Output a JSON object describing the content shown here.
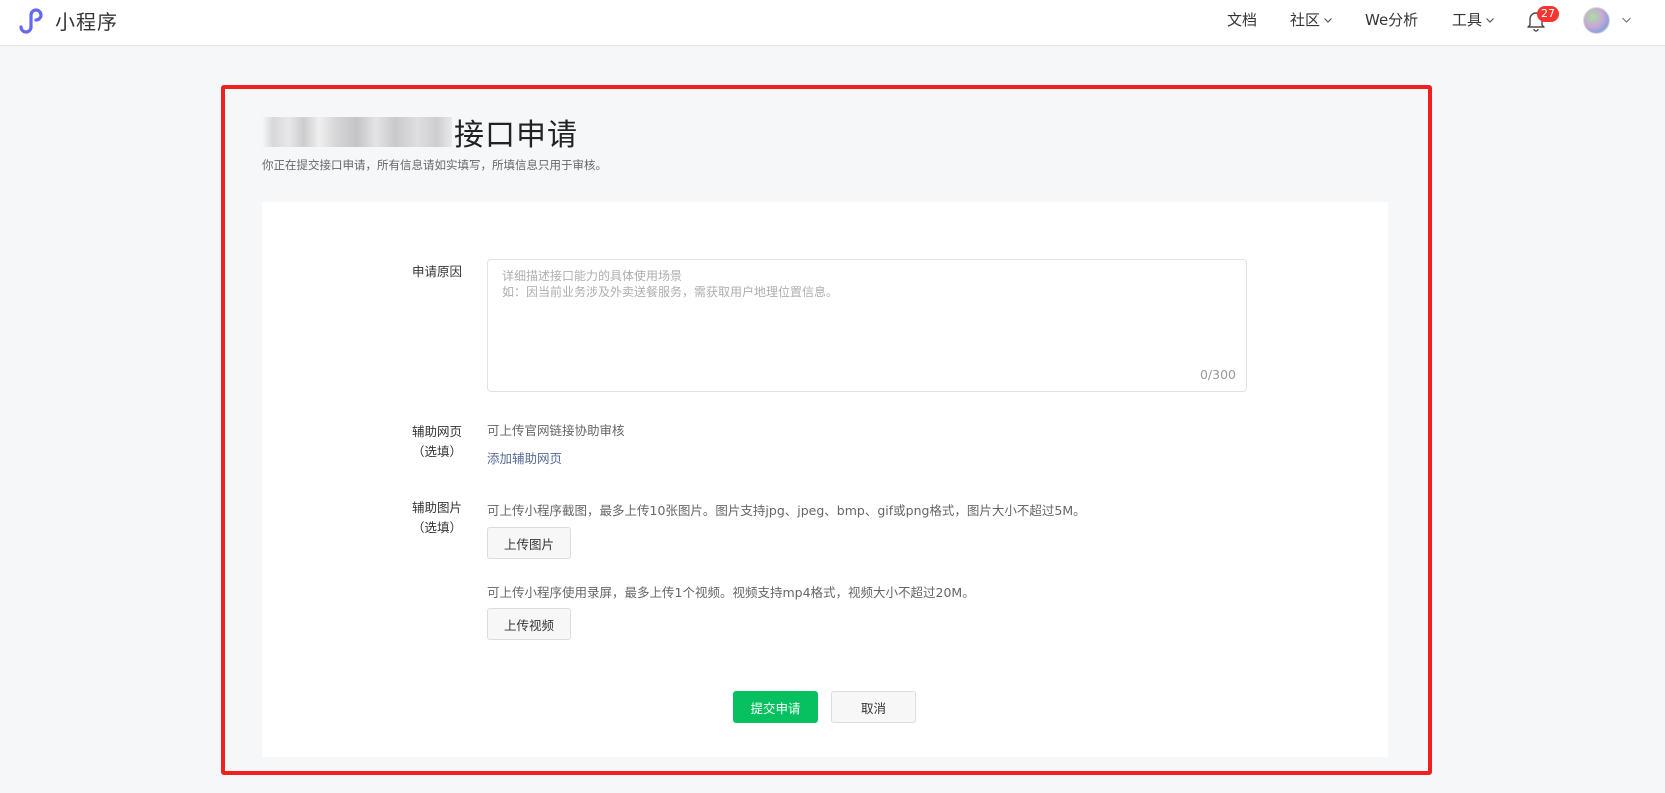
{
  "app": {
    "name": "小程序"
  },
  "nav": {
    "items": [
      {
        "label": "文档",
        "has_dropdown": false
      },
      {
        "label": "社区",
        "has_dropdown": true
      },
      {
        "label": "We分析",
        "has_dropdown": false
      },
      {
        "label": "工具",
        "has_dropdown": true
      }
    ],
    "notification_count": "27"
  },
  "page": {
    "title_suffix": "接口申请",
    "subtitle": "你正在提交接口申请，所有信息请如实填写，所填信息只用于审核。"
  },
  "form": {
    "reason": {
      "label": "申请原因",
      "placeholder": "详细描述接口能力的具体使用场景\n如：因当前业务涉及外卖送餐服务，需获取用户地理位置信息。",
      "value": "",
      "counter": "0/300"
    },
    "webpage": {
      "label": "辅助网页",
      "label_sub": "（选填）",
      "hint": "可上传官网链接协助审核",
      "add_link": "添加辅助网页"
    },
    "images": {
      "label": "辅助图片",
      "label_sub": "（选填）",
      "image_hint": "可上传小程序截图，最多上传10张图片。图片支持jpg、jpeg、bmp、gif或png格式，图片大小不超过5M。",
      "upload_image": "上传图片",
      "video_hint": "可上传小程序使用录屏，最多上传1个视频。视频支持mp4格式，视频大小不超过20M。",
      "upload_video": "上传视频"
    },
    "submit": "提交申请",
    "cancel": "取消"
  },
  "colors": {
    "primary": "#07c160",
    "link": "#576b95",
    "badge": "#f43530",
    "annotation_frame": "#f11f1f",
    "logo": "#6467f0"
  }
}
